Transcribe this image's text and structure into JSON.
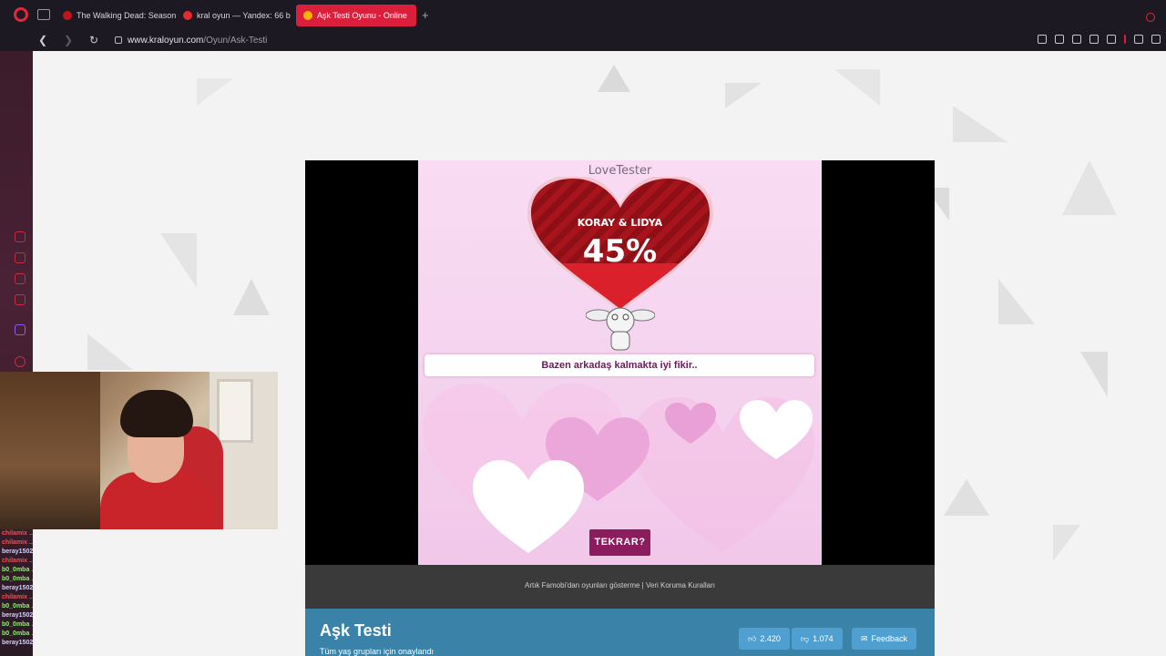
{
  "browser": {
    "tabs": [
      {
        "title": "The Walking Dead: Season",
        "favicon_color": "#c0151e",
        "active": false
      },
      {
        "title": "kral oyun — Yandex: 66 b",
        "favicon_color": "#e52b2b",
        "active": false
      },
      {
        "title": "Aşk Testi Oyunu - Online",
        "favicon_color": "#f4b400",
        "active": true
      }
    ],
    "new_tab": "+",
    "url_host": "www.kraloyun.com",
    "url_path": "/Oyun/Ask-Testi",
    "accent": "#d91f3c"
  },
  "game": {
    "logo": "LoveTester",
    "names": "KORAY & LIDYA",
    "percent": "45%",
    "percent_value": 45,
    "message": "Bazen arkadaş kalmakta iyi fikir..",
    "replay_label": "TEKRAR?"
  },
  "footer": {
    "text": "Artık Famobi'dan oyunları gösterme | Veri Koruma Kuralları"
  },
  "info": {
    "title": "Aşk Testi",
    "subtitle": "Tüm yaş grupları için onaylandı",
    "likes": "2.420",
    "dislikes": "1.074",
    "feedback": "Feedback"
  },
  "chat": [
    {
      "user": "chilamix",
      "color": "#ff4a4a",
      "text": "..."
    },
    {
      "user": "chilamix",
      "color": "#ff4a4a",
      "text": "..."
    },
    {
      "user": "beray1502",
      "color": "#d0d0ff",
      "text": "..."
    },
    {
      "user": "chilamix",
      "color": "#ff4a4a",
      "text": "..."
    },
    {
      "user": "b0_0mba",
      "color": "#7dff5a",
      "text": "..."
    },
    {
      "user": "b0_0mba",
      "color": "#7dff5a",
      "text": "..."
    },
    {
      "user": "beray1502",
      "color": "#d0d0ff",
      "text": "..."
    },
    {
      "user": "chilamix",
      "color": "#ff4a4a",
      "text": "..."
    },
    {
      "user": "b0_0mba",
      "color": "#7dff5a",
      "text": "..."
    },
    {
      "user": "beray1502",
      "color": "#d0d0ff",
      "text": "..."
    },
    {
      "user": "b0_0mba",
      "color": "#7dff5a",
      "text": "..."
    },
    {
      "user": "b0_0mba",
      "color": "#7dff5a",
      "text": "..."
    },
    {
      "user": "beray1502",
      "color": "#d0d0ff",
      "text": "..."
    }
  ]
}
